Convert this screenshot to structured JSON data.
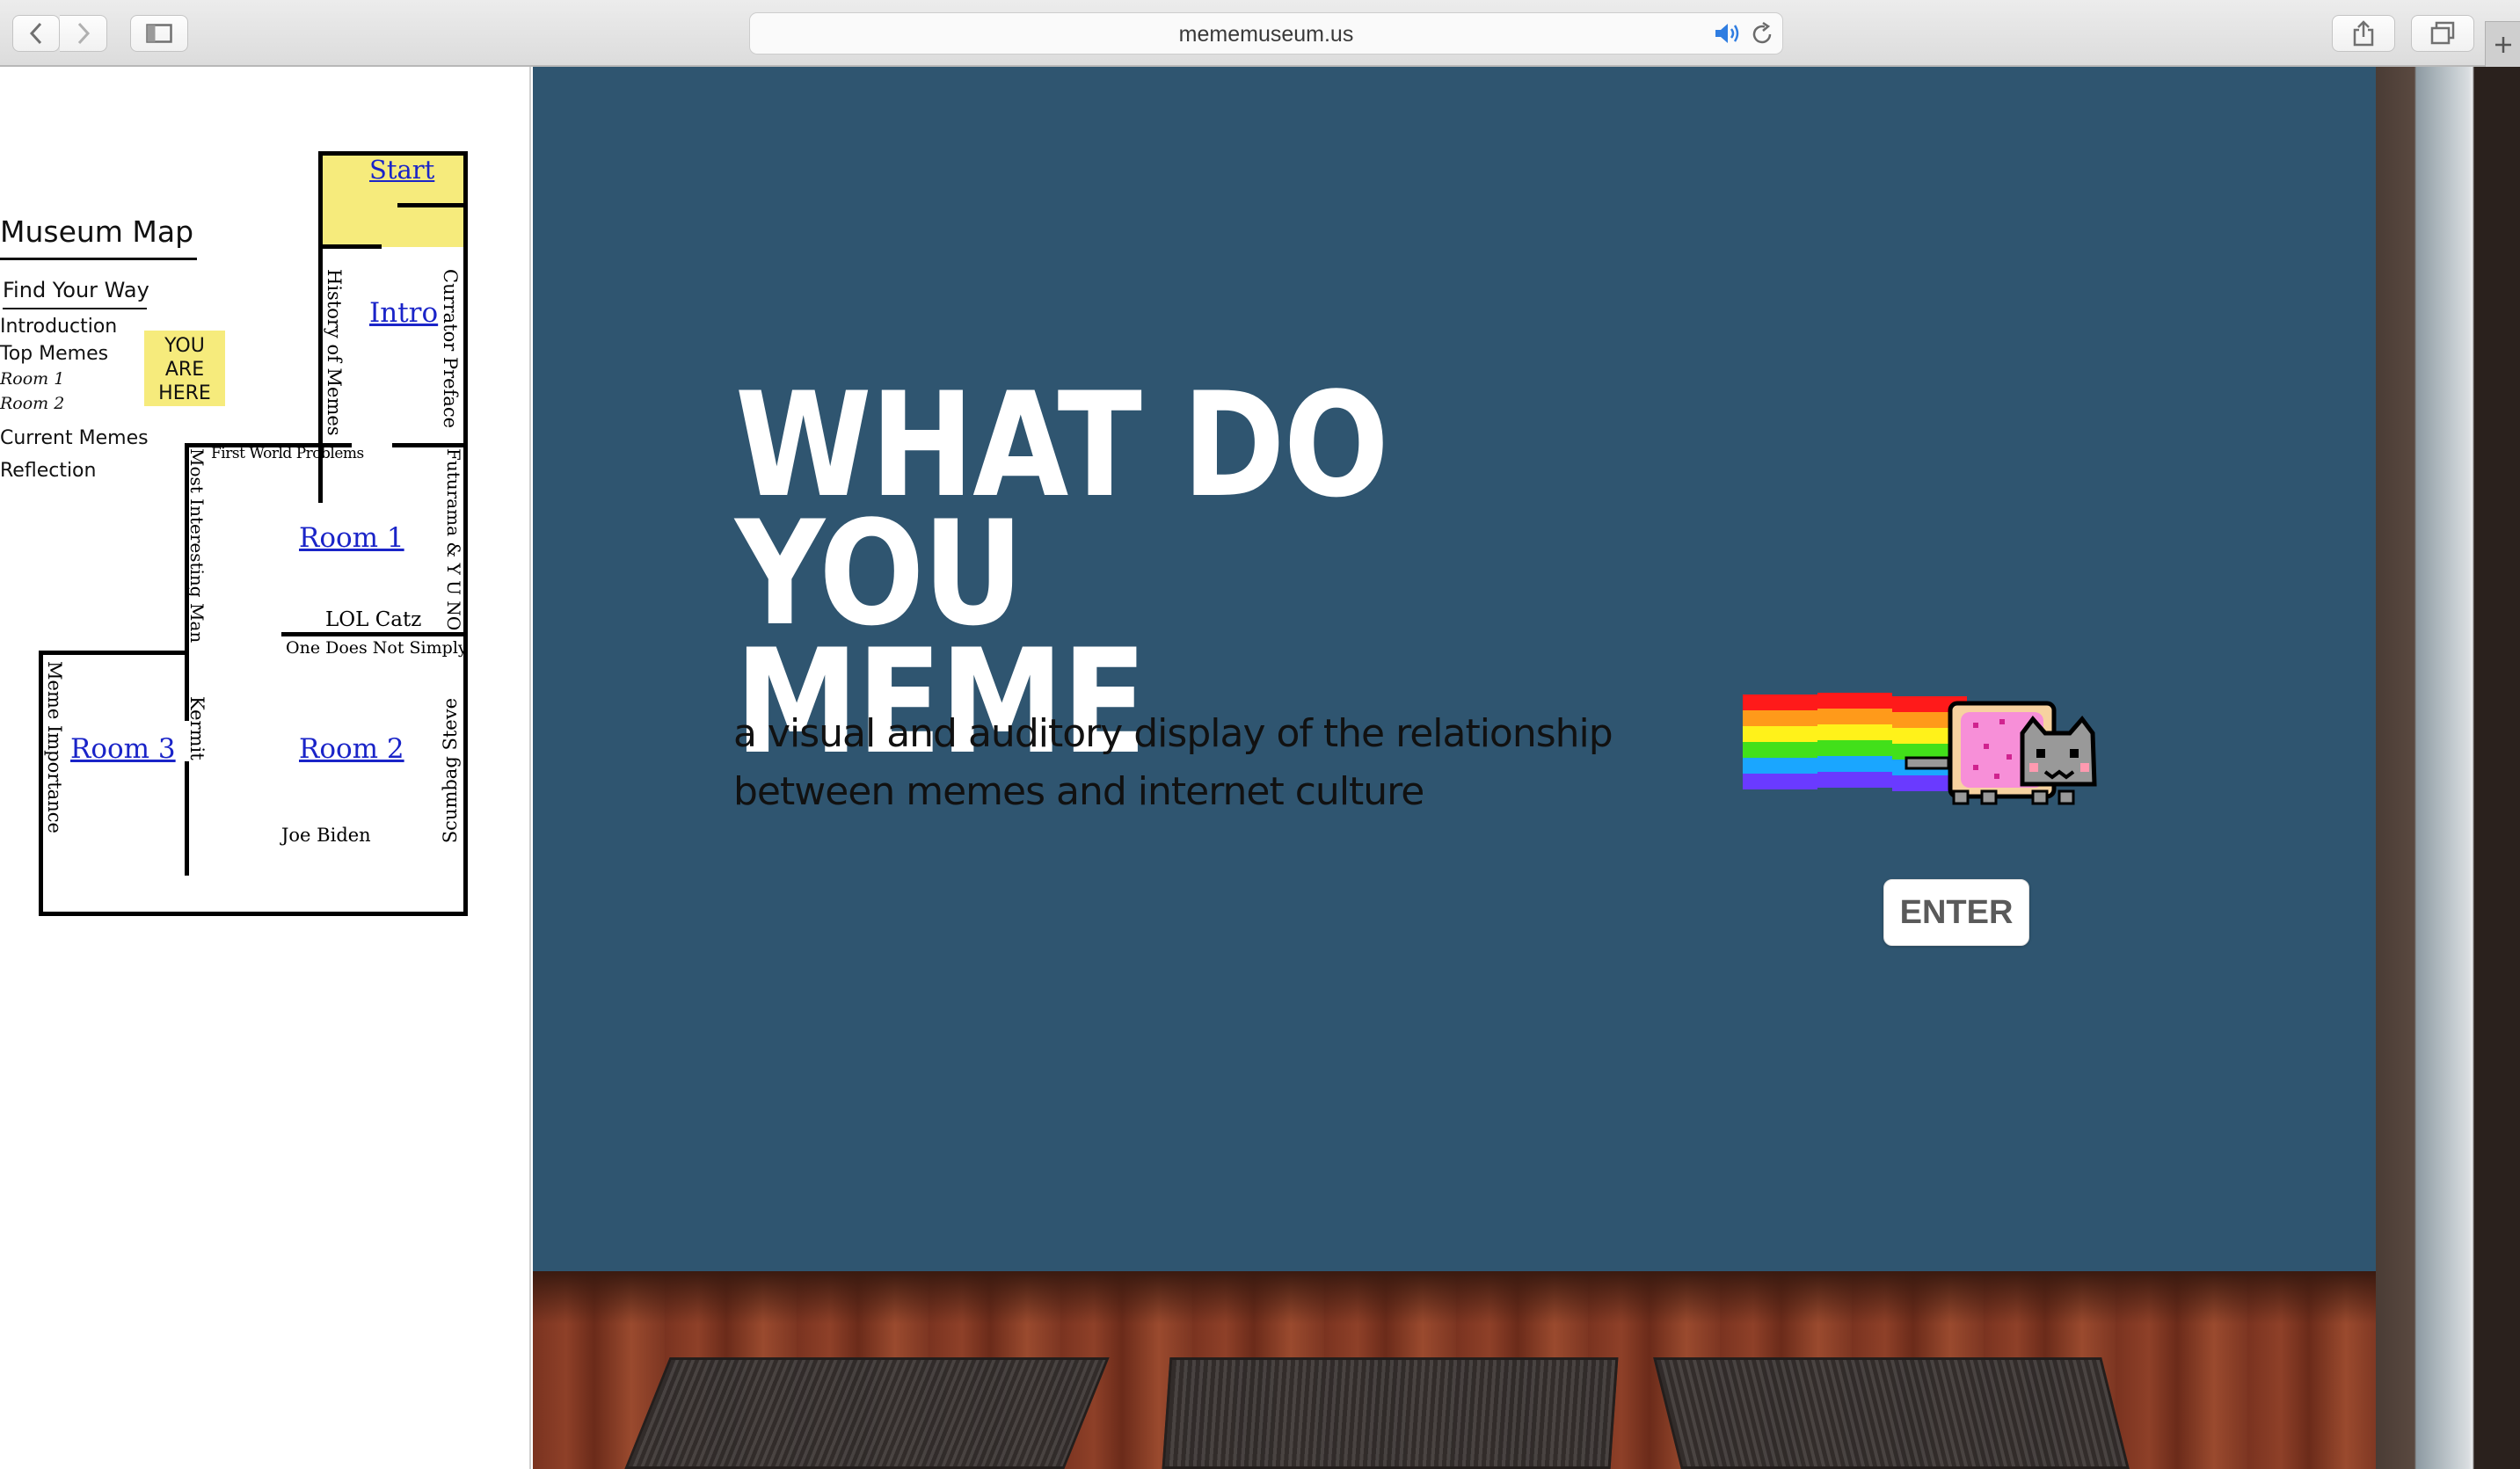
{
  "browser": {
    "url": "mememuseum.us"
  },
  "sidebar": {
    "museum_map_title": "Museum Map",
    "find_your_way": "Find Your Way",
    "nav": {
      "introduction": "Introduction",
      "top_memes": "Top Memes",
      "room_1": "Room  1",
      "room_2": "Room 2",
      "current_memes": "Current Memes",
      "reflection": "Reflection"
    },
    "you_are_here": "YOU ARE HERE"
  },
  "map": {
    "start": "Start",
    "intro": "Intro",
    "room1": "Room  1",
    "room2": "Room  2",
    "room3": "Room  3",
    "history_of_memes": "History of Memes",
    "currator_preface": "Currator Preface",
    "first_world_problems": "First World Problems",
    "most_interesting_man": "Most Interesting Man",
    "futurama_yuno": "Futurama & Y U NO",
    "lol_catz": "LOL Catz",
    "one_does_not_simply": "One Does Not Simply",
    "meme_importance": "Meme Importance",
    "kermit": "Kermit",
    "scumbag_steve": "Scumbag Steve",
    "joe_biden": "Joe Biden"
  },
  "hero": {
    "headline_line1": "WHAT DO",
    "headline_line2": "YOU MEME",
    "subtitle": "a visual and auditory display of the relationship between memes and internet culture",
    "enter_label": "ENTER"
  },
  "colors": {
    "wall": "#2f5570",
    "map_highlight": "#f6eb7c",
    "link": "#1a24c8"
  }
}
